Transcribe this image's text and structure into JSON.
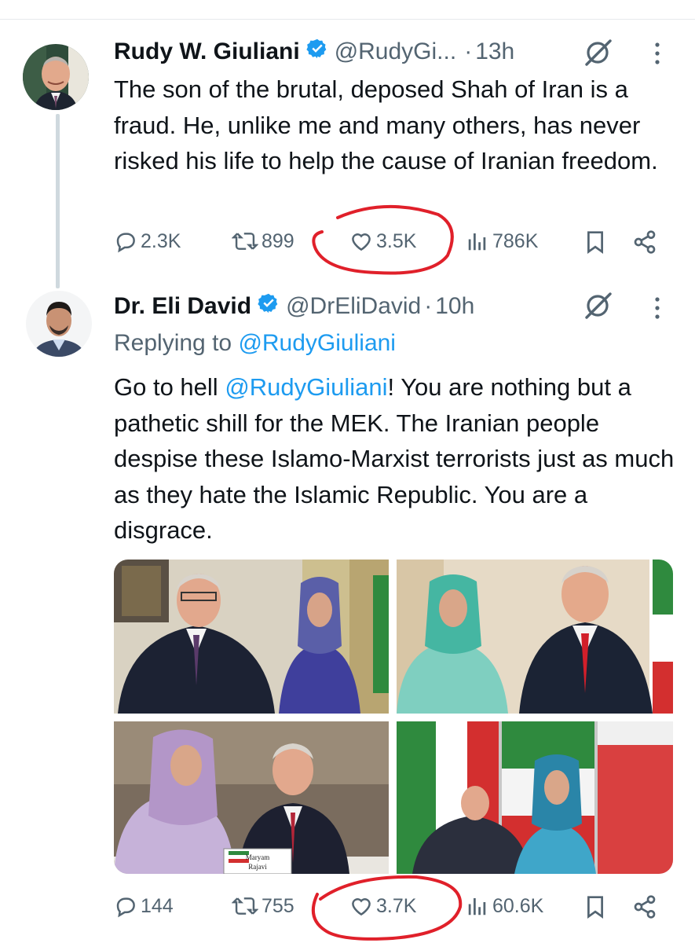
{
  "colors": {
    "text": "#0f1419",
    "secondary": "#536471",
    "link": "#1d9bf0",
    "annotation": "#e0202a",
    "thread_line": "#cfd9de"
  },
  "tweet1": {
    "name": "Rudy W. Giuliani",
    "handle": "@RudyGi...",
    "dot": "·",
    "time": "13h",
    "text": "The son of the brutal, deposed Shah of Iran is a fraud. He, unlike me and many others, has never risked his life to help the cause of Iranian freedom.",
    "actions": {
      "replies": "2.3K",
      "reposts": "899",
      "likes": "3.5K",
      "views": "786K"
    }
  },
  "tweet2": {
    "name": "Dr. Eli David",
    "handle": "@DrEliDavid",
    "dot": "·",
    "time": "10h",
    "replying_prefix": "Replying to ",
    "replying_handle": "@RudyGiuliani",
    "text_before": "Go to hell ",
    "text_mention": "@RudyGiuliani",
    "text_after": "! You are nothing but a pathetic shill for the MEK. The Iranian people despise these Islamo-Marxist terrorists just as much as they hate the Islamic Republic. You are a disgrace.",
    "photo_captions": [
      "Maryam",
      "Rajavi"
    ],
    "actions": {
      "replies": "144",
      "reposts": "755",
      "likes": "3.7K",
      "views": "60.6K"
    }
  },
  "icons": {
    "verified": "verified-badge-icon",
    "grok": "grok-icon",
    "more": "more-vertical-icon",
    "reply": "reply-icon",
    "repost": "repost-icon",
    "like": "heart-icon",
    "views": "views-icon",
    "bookmark": "bookmark-icon",
    "share": "share-icon"
  }
}
